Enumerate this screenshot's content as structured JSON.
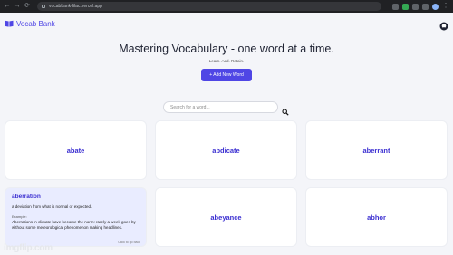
{
  "browser": {
    "url": "vocabbank-lilac.vercel.app"
  },
  "header": {
    "brand": "Vocab Bank",
    "brand_color": "#4f46e5"
  },
  "hero": {
    "title": "Mastering Vocabulary - one word at a time.",
    "subtitle": "Learn. Add. Retain.",
    "add_button": "+ Add New Word"
  },
  "search": {
    "placeholder": "Search for a word..."
  },
  "cards": [
    {
      "word": "abate"
    },
    {
      "word": "abdicate"
    },
    {
      "word": "aberrant"
    },
    {
      "word": "aberration",
      "definition": "a deviation from what is normal or expected.",
      "example_label": "Example:",
      "example": "Aberrations in climate have become the norm: rarely a week goes by without some meteorological phenomenon making headlines.",
      "back_hint": "Click to go back"
    },
    {
      "word": "abeyance"
    },
    {
      "word": "abhor"
    }
  ],
  "watermark": "imgflip.com",
  "icons": {
    "logo": "book-icon",
    "github": "github-icon",
    "search": "search-icon"
  }
}
